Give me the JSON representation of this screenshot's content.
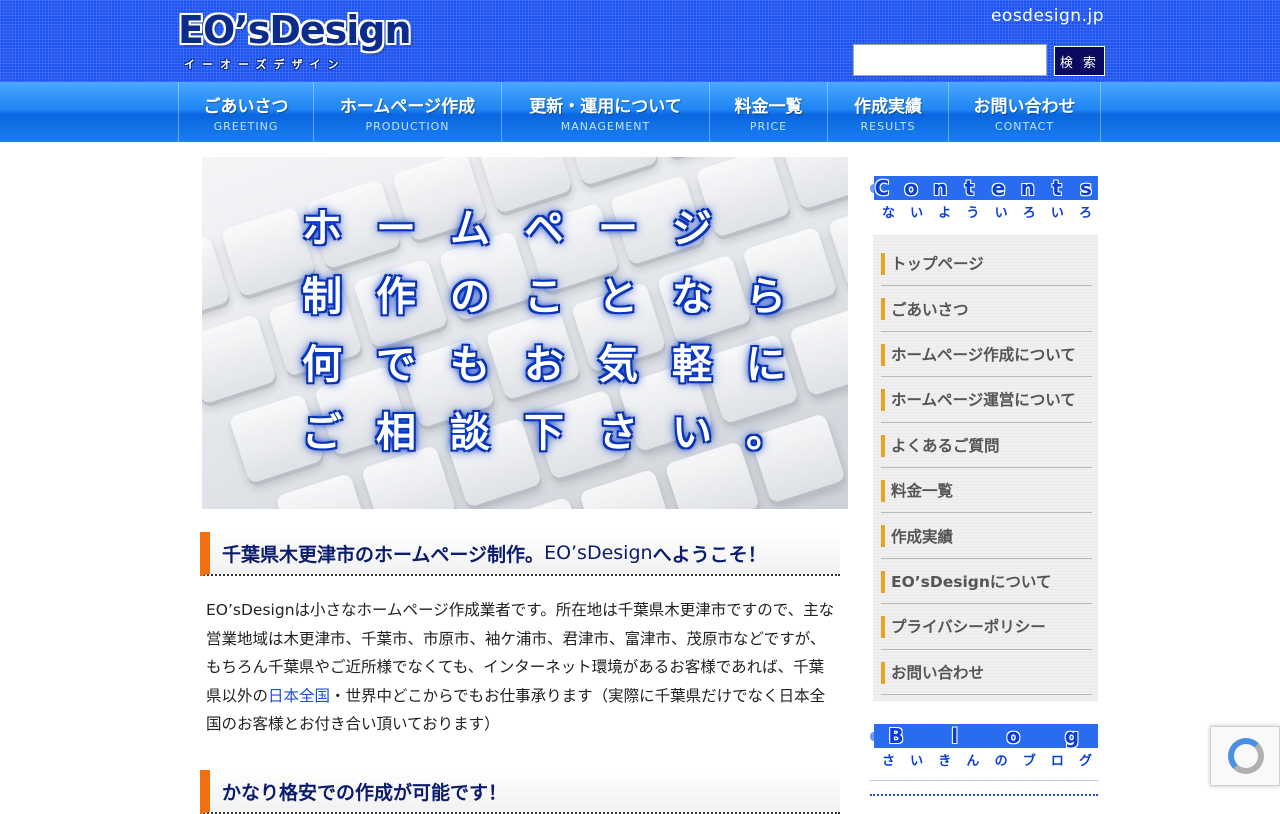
{
  "header": {
    "logo_text": "EO’sDesign",
    "logo_sub": "イーオーズデザイン",
    "domain": "eosdesign.jp",
    "search_placeholder": "",
    "search_button": "検 索"
  },
  "nav": [
    {
      "jp": "ごあいさつ",
      "en": "GREETING"
    },
    {
      "jp": "ホームページ作成",
      "en": "PRODUCTION"
    },
    {
      "jp": "更新・運用について",
      "en": "MANAGEMENT"
    },
    {
      "jp": "料金一覧",
      "en": "PRICE"
    },
    {
      "jp": "作成実績",
      "en": "RESULTS"
    },
    {
      "jp": "お問い合わせ",
      "en": "CONTACT"
    }
  ],
  "hero": {
    "lines": [
      "ホームページ",
      "制作のことなら",
      "何でもお気軽に",
      "ご相談下さい。"
    ]
  },
  "main": {
    "heading1_prefix": "千葉県木更津市のホームページ制作。",
    "heading1_brand": "EO’sDesign",
    "heading1_suffix": "へようこそ！",
    "para_1": "EO’sDesignは小さなホームページ作成業者です。所在地は千葉県木更津市ですので、主な営業地域は木更津市、千葉市、市原市、袖ケ浦市、君津市、富津市、茂原市などですが、もちろん千葉県やご近所様でなくても、インターネット環境があるお客様であれば、千葉県以外の",
    "para_link": "日本全国",
    "para_2": "・世界中どこからでもお仕事承ります（実際に千葉県だけでなく日本全国のお客様とお付き合い頂いております）",
    "heading2": "かなり格安での作成が可能です！"
  },
  "sidebar": {
    "contents_title_en": "Contents",
    "contents_title_jp": "ないよういろいろ",
    "menu": [
      "トップページ",
      "ごあいさつ",
      "ホームページ作成について",
      "ホームページ運営について",
      "よくあるご質問",
      "料金一覧",
      "作成実績",
      "EO’sDesignについて",
      "プライバシーポリシー",
      "お問い合わせ"
    ],
    "blog_title_en": "Blog",
    "blog_title_jp": "さいきんのブログ"
  },
  "colors": {
    "header_blue": "#1c52f0",
    "nav_blue": "#1f86f4",
    "heading_accent": "#f07010",
    "menu_accent": "#f0a020",
    "heading_text": "#0b1b6e"
  }
}
